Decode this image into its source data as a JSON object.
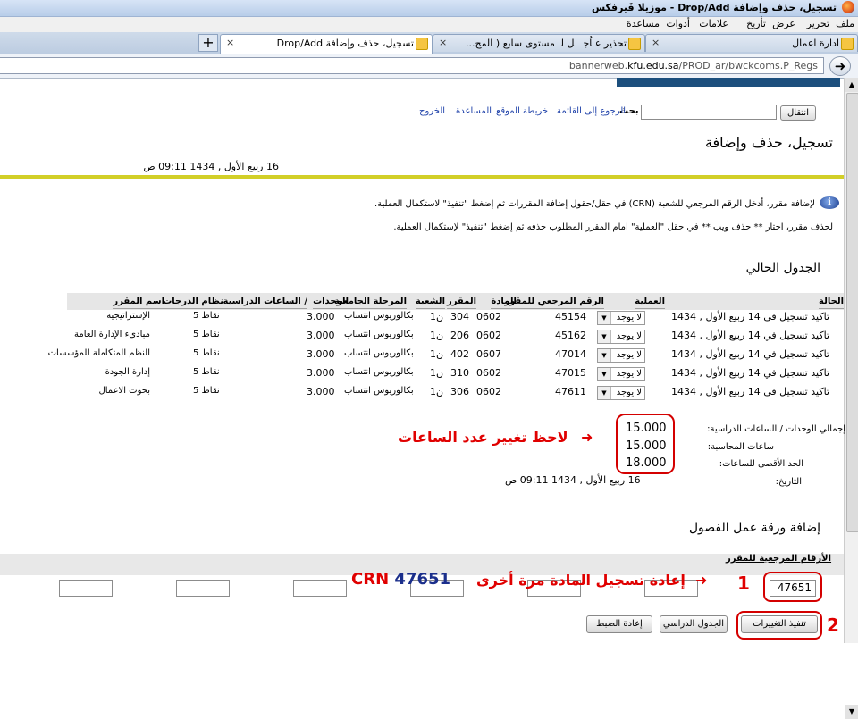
{
  "window_title": "تسجيل، حذف وإضافة Drop/Add - موزيلا فَيرفكس",
  "menu": [
    "ملف",
    "تحرير",
    "عرض",
    "تأريخ",
    "علامات",
    "أدوات",
    "مساعدة"
  ],
  "tabs": [
    {
      "label": "تسجيل، حذف وإضافة Drop/Add"
    },
    {
      "label": "تحذير عـاُجـــل لـ مستوى سابع ( المح..."
    },
    {
      "label": "ادارة اعمال"
    }
  ],
  "new_tab": "+",
  "close_glyph": "×",
  "url": {
    "host": "bannerweb.",
    "domain": "kfu.edu.sa",
    "path": "/PROD_ar/bwckcoms.P_Regs"
  },
  "go_glyph": "➜",
  "header": {
    "exit_button": "انتقال",
    "search_label": "بحث",
    "links": [
      "الرجوع إلى القائمة",
      "خريطة الموقع",
      "المساعدة",
      "الخروج"
    ]
  },
  "page_title": "تسجيل، حذف وإضافة",
  "datetime": "16 ربيع الأول , 1434 09:11 ص",
  "info_icon": "i",
  "instructions": [
    "لإضافة مقرر، أدخل الرقم المرجعي للشعبة (CRN) في حقل/حقول إضافة المقررات ثم إضغط \"تنفيذ\" لاستكمال العملية.",
    "لحذف مقرر، اختار ** حذف ويب ** في حقل \"العملية\" امام المقرر المطلوب حذفه ثم إضغط \"تنفيذ\" لإستكمال العملية."
  ],
  "schedule_heading": "الجدول الحالي",
  "table": {
    "headers": {
      "status": "الحالة",
      "action": "العملية",
      "crn": "الرقم المرجعي للمقرر",
      "subject": "المادة",
      "course": "المقرر",
      "section": "الشعبة",
      "level": "المرحلة الجامعية",
      "credits": "الوحدات",
      "hours": "/ الساعات الدراسية",
      "grade_mode": "نظام الدرجات",
      "title": "اسم المقرر"
    },
    "rows": [
      {
        "status": "تاكيد تسجيل في 14 ربيع الأول , 1434",
        "action": "لا يوجد",
        "crn": "45154",
        "subject": "0602",
        "course": "304",
        "section": "ن1",
        "level": "بكالوريوس انتساب",
        "credits": "3.000",
        "grade_mode": "نقاط 5",
        "title": "الإستراتيجية"
      },
      {
        "status": "تاكيد تسجيل في 14 ربيع الأول , 1434",
        "action": "لا يوجد",
        "crn": "45162",
        "subject": "0602",
        "course": "206",
        "section": "ن1",
        "level": "بكالوريوس انتساب",
        "credits": "3.000",
        "grade_mode": "نقاط 5",
        "title": "مبادىء الإدارة العامة"
      },
      {
        "status": "تاكيد تسجيل في 14 ربيع الأول , 1434",
        "action": "لا يوجد",
        "crn": "47014",
        "subject": "0607",
        "course": "402",
        "section": "ن1",
        "level": "بكالوريوس انتساب",
        "credits": "3.000",
        "grade_mode": "نقاط 5",
        "title": "النظم المتكاملة للمؤسسات"
      },
      {
        "status": "تاكيد تسجيل في 14 ربيع الأول , 1434",
        "action": "لا يوجد",
        "crn": "47015",
        "subject": "0602",
        "course": "310",
        "section": "ن1",
        "level": "بكالوريوس انتساب",
        "credits": "3.000",
        "grade_mode": "نقاط 5",
        "title": "إدارة الجودة"
      },
      {
        "status": "تاكيد تسجيل في 14 ربيع الأول , 1434",
        "action": "لا يوجد",
        "crn": "47611",
        "subject": "0602",
        "course": "306",
        "section": "ن1",
        "level": "بكالوريوس انتساب",
        "credits": "3.000",
        "grade_mode": "نقاط 5",
        "title": "بحوث الاعمال"
      }
    ]
  },
  "totals": {
    "total_label": "إجمالي الوحدات / الساعات الدراسية:",
    "total_value": "15.000",
    "billing_label": "ساعات المحاسبة:",
    "billing_value": "15.000",
    "max_label": "الحد الأقصى للساعات:",
    "max_value": "18.000",
    "date_label": "التاريخ:",
    "date_value": "16 ربيع الأول , 1434 09:11 ص"
  },
  "annotations": {
    "note_hours": "لاحظ تغيير عدد الساعات",
    "step1_num": "1",
    "step1_text": "إعادة تسجيل المادة مرة أخرى",
    "crn_prefix": "CRN",
    "crn_number": "47651",
    "step2_num": "2",
    "arrow": "➜"
  },
  "add_section": {
    "heading": "إضافة ورقة عمل الفصول",
    "crn_label": "الأرقام المرجعية للمقرر",
    "crn_value": "47651"
  },
  "buttons": {
    "submit": "تنفيذ التغييرات",
    "schedule": "الجدول الدراسي",
    "reset": "إعادة الضبط"
  },
  "colors": {
    "annotation": "#e00000",
    "rule": "#d2cf28",
    "link": "#1c3fa8"
  }
}
